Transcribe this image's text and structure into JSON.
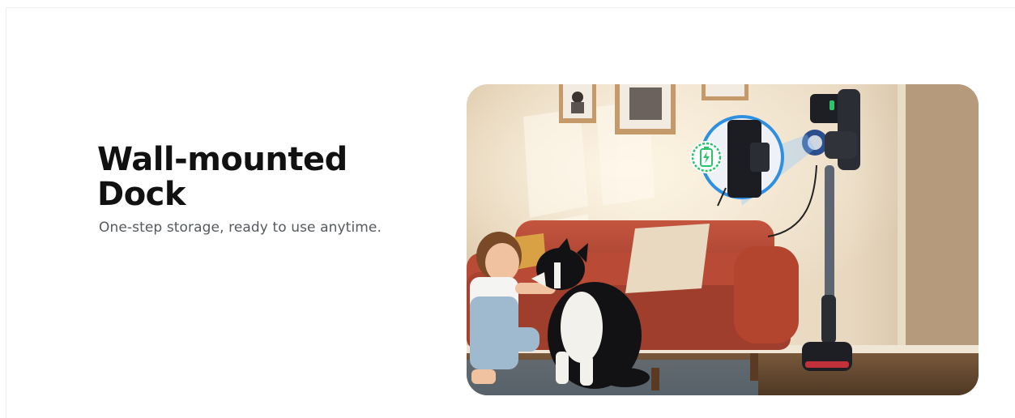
{
  "feature": {
    "title_line1": "Wall-mounted",
    "title_line2": "Dock",
    "subtitle": "One-step storage, ready to use anytime."
  },
  "image": {
    "icons": [
      "charging-battery-icon"
    ],
    "colors": {
      "wall": "#eadbc4",
      "sofa": "#b84a36",
      "charge_ring": "#2f8fe0",
      "battery_green": "#2cc36b",
      "vacuum_accent": "#2b4f8c"
    }
  }
}
